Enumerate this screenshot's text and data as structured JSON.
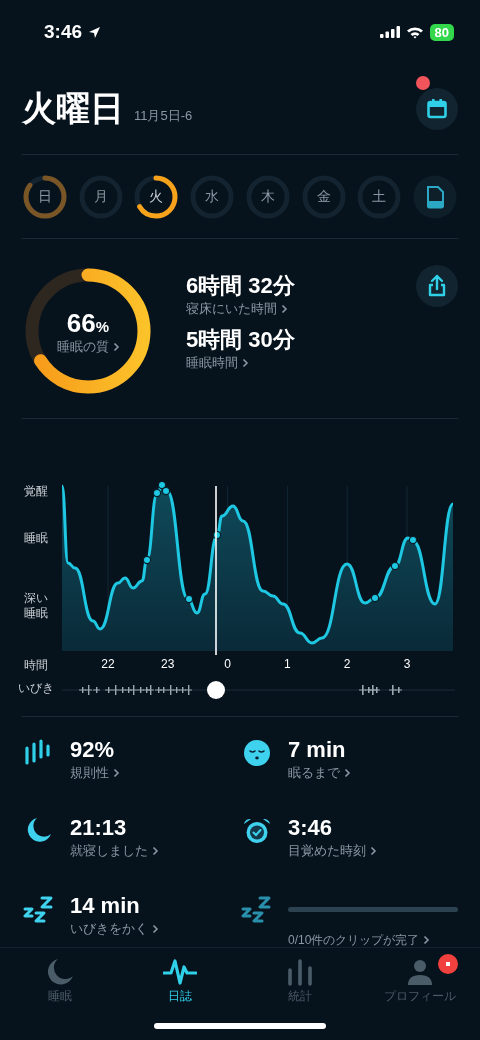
{
  "status_bar": {
    "time": "3:46",
    "battery": "80"
  },
  "header": {
    "title": "火曜日",
    "date": "11月5日-6",
    "calendar_notification": true
  },
  "days": [
    {
      "label": "日",
      "selected": false
    },
    {
      "label": "月",
      "selected": false
    },
    {
      "label": "火",
      "selected": true
    },
    {
      "label": "水",
      "selected": false
    },
    {
      "label": "木",
      "selected": false
    },
    {
      "label": "金",
      "selected": false
    },
    {
      "label": "土",
      "selected": false
    }
  ],
  "summary": {
    "quality": {
      "value": "66",
      "unit": "%",
      "label": "睡眠の質"
    },
    "durations": [
      {
        "value": "6時間 32分",
        "label": "寝床にいた時間"
      },
      {
        "value": "5時間 30分",
        "label": "睡眠時間"
      }
    ]
  },
  "chart": {
    "y_labels": [
      "覚醒",
      "睡眠",
      "深い睡眠"
    ],
    "x_label": "時間",
    "hours": [
      "22",
      "23",
      "0",
      "1",
      "2",
      "3"
    ],
    "snore_label": "いびき"
  },
  "stats": [
    {
      "kind": "stat",
      "value": "92%",
      "label": "規則性"
    },
    {
      "kind": "stat",
      "value": "7 min",
      "label": "眠るまで"
    },
    {
      "kind": "stat",
      "value": "21:13",
      "label": "就寝しました"
    },
    {
      "kind": "stat",
      "value": "3:46",
      "label": "目覚めた時刻"
    },
    {
      "kind": "stat",
      "value": "14 min",
      "label": "いびきをかく"
    },
    {
      "kind": "progress",
      "level": 0,
      "label": "0/10件のクリップが完了"
    }
  ],
  "nav": [
    {
      "label": "睡眠",
      "selected": false,
      "badge": false
    },
    {
      "label": "日誌",
      "selected": true,
      "badge": false
    },
    {
      "label": "統計",
      "selected": false,
      "badge": false
    },
    {
      "label": "プロフィール",
      "selected": false,
      "badge": true
    }
  ]
}
